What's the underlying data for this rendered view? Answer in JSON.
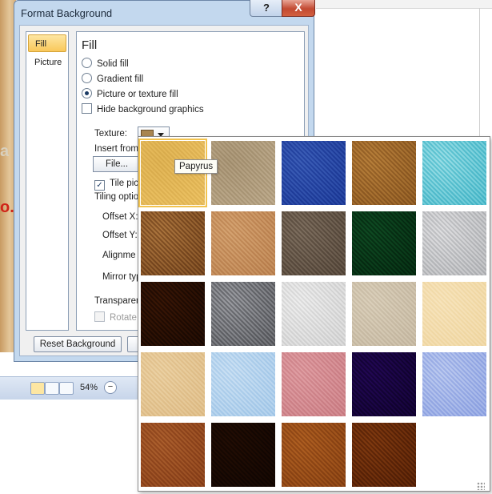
{
  "background": {
    "slide_letters": [
      "a",
      "o.("
    ],
    "zoom": "54%",
    "zoom_minus": "−"
  },
  "dialog": {
    "title": "Format Background",
    "help_label": "?",
    "close_label": "X",
    "nav": [
      {
        "label": "Fill",
        "selected": true
      },
      {
        "label": "Picture",
        "selected": false
      }
    ],
    "panel": {
      "heading": "Fill",
      "options": [
        {
          "label": "Solid fill",
          "type": "radio",
          "checked": false
        },
        {
          "label": "Gradient fill",
          "type": "radio",
          "checked": false
        },
        {
          "label": "Picture or texture fill",
          "type": "radio",
          "checked": true
        },
        {
          "label": "Hide background graphics",
          "type": "checkbox",
          "checked": false
        }
      ],
      "texture_label": "Texture:",
      "insert_from_label": "Insert from",
      "file_button": "File...",
      "tile_label": "Tile pic",
      "tiling_options_label": "Tiling option",
      "offset_x_label": "Offset X:",
      "offset_y_label": "Offset Y:",
      "alignment_label": "Alignme",
      "mirror_label": "Mirror typ",
      "transparency_label": "Transparen",
      "rotate_label": "Rotate"
    },
    "reset_button": "Reset Background"
  },
  "gallery": {
    "tooltip": "Papyrus",
    "selected_index": 0,
    "tiles": [
      {
        "name": "papyrus",
        "c1": "#f6dfa0",
        "c2": "#ead08a"
      },
      {
        "name": "canvas",
        "c1": "#ddd2bf",
        "c2": "#c9bca5"
      },
      {
        "name": "denim",
        "c1": "#4f73c0",
        "c2": "#7c9bd8"
      },
      {
        "name": "woven-mat",
        "c1": "#b58e55",
        "c2": "#d8b47a"
      },
      {
        "name": "water-droplets",
        "c1": "#7fd4df",
        "c2": "#c6eef2"
      },
      {
        "name": "paper-bag",
        "c1": "#a27a4d",
        "c2": "#d1ad7e"
      },
      {
        "name": "fish-fossil",
        "c1": "#d6b088",
        "c2": "#e9ccaa"
      },
      {
        "name": "sand",
        "c1": "#8c7f72",
        "c2": "#b3a89c"
      },
      {
        "name": "green-marble",
        "c1": "#1e5e3b",
        "c2": "#3e8a5e"
      },
      {
        "name": "white-marble",
        "c1": "#cfd0d2",
        "c2": "#eeeeef"
      },
      {
        "name": "brown-marble",
        "c1": "#4b2c14",
        "c2": "#7a4c25"
      },
      {
        "name": "granite",
        "c1": "#8e8f93",
        "c2": "#c7c8cb"
      },
      {
        "name": "newsprint",
        "c1": "#e3e3e3",
        "c2": "#f6f6f6"
      },
      {
        "name": "recycled-paper",
        "c1": "#ddd5c7",
        "c2": "#ece6da"
      },
      {
        "name": "parchment",
        "c1": "#f6e8c8",
        "c2": "#fbf1db"
      },
      {
        "name": "stationery",
        "c1": "#ecd8b5",
        "c2": "#f5e7cc"
      },
      {
        "name": "blue-tissue-paper",
        "c1": "#c8dff2",
        "c2": "#e3eff9"
      },
      {
        "name": "pink-tissue-paper",
        "c1": "#e0aeb3",
        "c2": "#efc9cc"
      },
      {
        "name": "purple-mesh",
        "c1": "#3b1566",
        "c2": "#5d2c92"
      },
      {
        "name": "bouquet",
        "c1": "#b9c7ee",
        "c2": "#dbe3f7"
      },
      {
        "name": "cork",
        "c1": "#b5794a",
        "c2": "#d19c6c"
      },
      {
        "name": "walnut",
        "c1": "#3d2412",
        "c2": "#5e3a1f"
      },
      {
        "name": "oak",
        "c1": "#b37a3f",
        "c2": "#d39c5d"
      },
      {
        "name": "medium-wood",
        "c1": "#8a5322",
        "c2": "#b57a40"
      }
    ]
  }
}
